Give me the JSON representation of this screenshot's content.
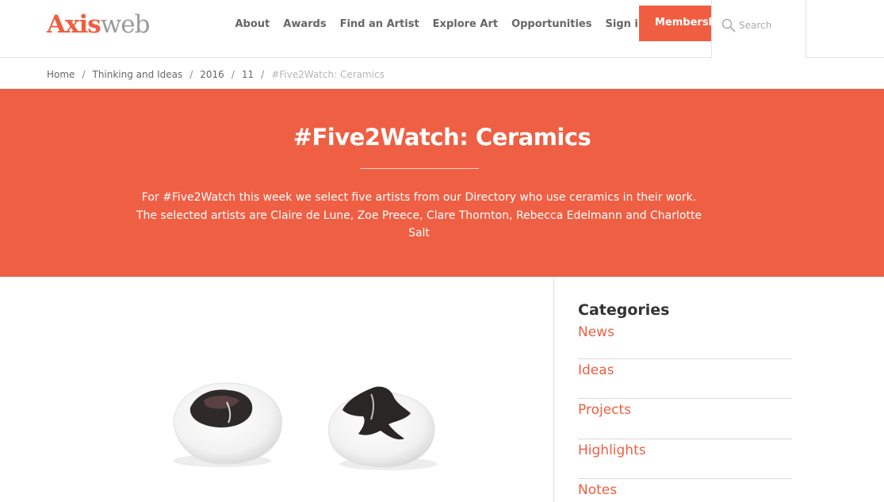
{
  "header": {
    "logo": {
      "part1": "Axis",
      "part2": "web"
    },
    "nav": [
      "About",
      "Awards",
      "Find an Artist",
      "Explore Art",
      "Opportunities",
      "Sign in"
    ],
    "membership_label": "Membership",
    "search_placeholder": "Search"
  },
  "breadcrumb": [
    "Home",
    "Thinking and Ideas",
    "2016",
    "11",
    "#Five2Watch: Ceramics"
  ],
  "hero": {
    "title": "#Five2Watch: Ceramics",
    "intro": "For #Five2Watch this week we select five artists from our Directory who use ceramics in their work. The selected artists are Claire de Lune, Zoe Preece, Clare Thornton, Rebecca Edelmann and Charlotte Salt"
  },
  "sidebar": {
    "heading": "Categories",
    "categories": [
      "News",
      "Ideas",
      "Projects",
      "Highlights",
      "Notes"
    ]
  },
  "colors": {
    "accent": "#ef5e41",
    "hero_bg": "#ef5f43",
    "logo_grey": "#9b9b9b"
  }
}
